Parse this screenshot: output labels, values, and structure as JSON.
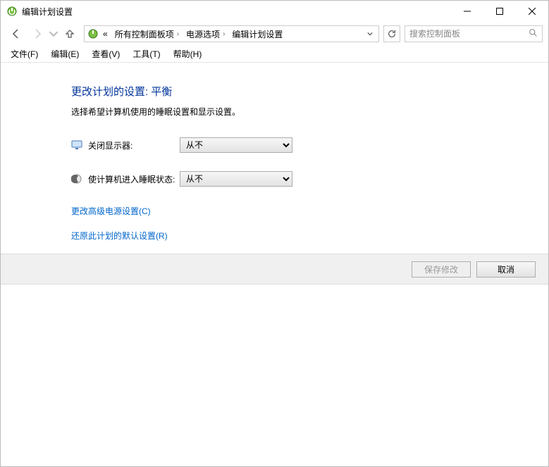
{
  "window": {
    "title": "编辑计划设置"
  },
  "breadcrumb": {
    "chev_prefix": "«",
    "items": [
      "所有控制面板项",
      "电源选项",
      "编辑计划设置"
    ]
  },
  "search": {
    "placeholder": "搜索控制面板"
  },
  "menu": {
    "file": "文件(F)",
    "edit": "编辑(E)",
    "view": "查看(V)",
    "tools": "工具(T)",
    "help": "帮助(H)"
  },
  "page": {
    "heading": "更改计划的设置: 平衡",
    "subtitle": "选择希望计算机使用的睡眠设置和显示设置。",
    "turn_off_display_label": "关闭显示器:",
    "sleep_label": "使计算机进入睡眠状态:",
    "option_never": "从不",
    "link_advanced": "更改高级电源设置(C)",
    "link_restore": "还原此计划的默认设置(R)",
    "save_label": "保存修改",
    "cancel_label": "取消"
  },
  "settings": {
    "turn_off_display_value": "从不",
    "sleep_value": "从不"
  }
}
